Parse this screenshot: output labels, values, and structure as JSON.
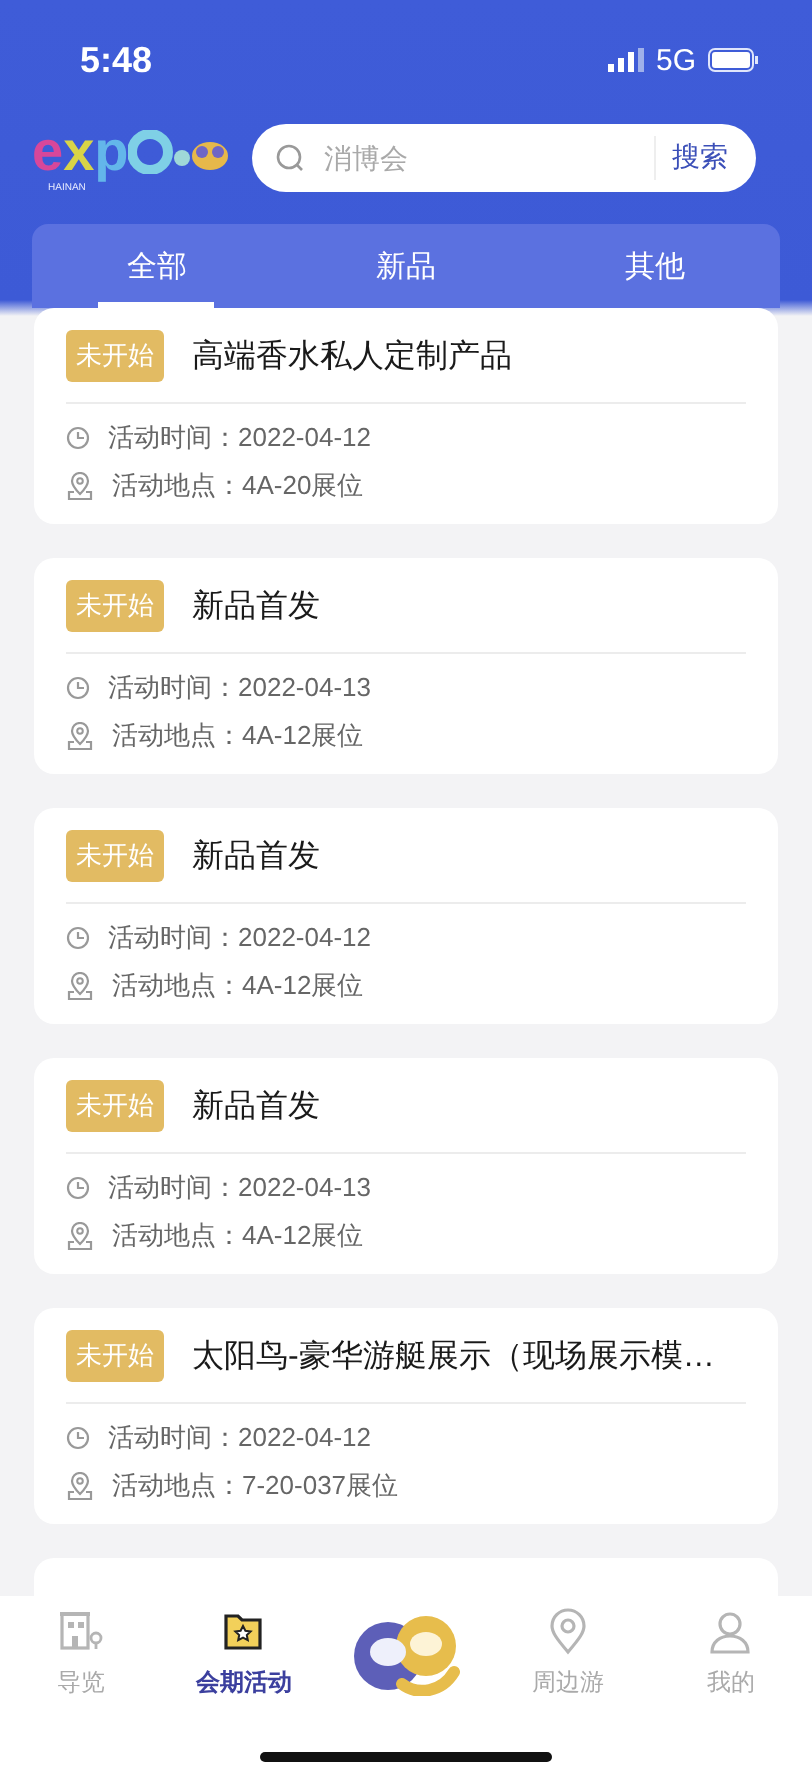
{
  "status_bar": {
    "time": "5:48",
    "network": "5G"
  },
  "logo": {
    "letters": [
      {
        "text": "e",
        "color": "#d8479a"
      },
      {
        "text": "x",
        "color": "#d9d447"
      },
      {
        "text": "p",
        "color": "#63b6ea"
      }
    ],
    "subtitle": "HAINAN"
  },
  "search": {
    "placeholder": "消博会",
    "button": "搜索"
  },
  "tabs": [
    {
      "label": "全部",
      "selected": true
    },
    {
      "label": "新品",
      "selected": false
    },
    {
      "label": "其他",
      "selected": false
    }
  ],
  "events": [
    {
      "status": "未开始",
      "title": "高端香水私人定制产品",
      "time": "活动时间：2022-04-12",
      "place": "活动地点：4A-20展位"
    },
    {
      "status": "未开始",
      "title": "新品首发",
      "time": "活动时间：2022-04-13",
      "place": "活动地点：4A-12展位"
    },
    {
      "status": "未开始",
      "title": "新品首发",
      "time": "活动时间：2022-04-12",
      "place": "活动地点：4A-12展位"
    },
    {
      "status": "未开始",
      "title": "新品首发",
      "time": "活动时间：2022-04-13",
      "place": "活动地点：4A-12展位"
    },
    {
      "status": "未开始",
      "title": "太阳鸟-豪华游艇展示（现场展示模…",
      "time": "活动时间：2022-04-12",
      "place": "活动地点：7-20-037展位"
    }
  ],
  "nav": [
    {
      "kind": "item",
      "label": "导览",
      "selected": false
    },
    {
      "kind": "item",
      "label": "会期活动",
      "selected": true
    },
    {
      "kind": "center"
    },
    {
      "kind": "item",
      "label": "周边游",
      "selected": false
    },
    {
      "kind": "item",
      "label": "我的",
      "selected": false
    }
  ]
}
